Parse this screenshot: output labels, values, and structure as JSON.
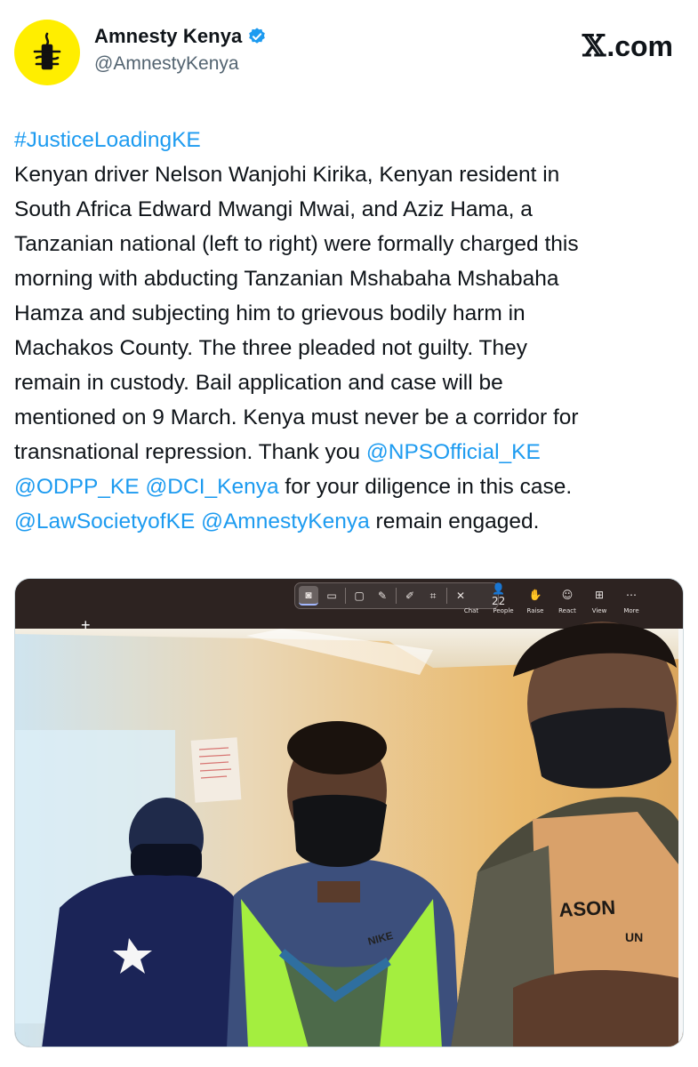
{
  "account": {
    "display_name": "Amnesty Kenya",
    "handle": "@AmnestyKenya",
    "verified": true,
    "avatar_icon": "amnesty-candle-icon",
    "avatar_color": "#ffee00"
  },
  "brand": {
    "site": ".com",
    "x_letter": "𝕏"
  },
  "tweet": {
    "lines": [
      [
        {
          "t": "#JusticeLoadingKE",
          "link": true
        }
      ],
      [
        {
          "t": "Kenyan driver Nelson Wanjohi Kirika, Kenyan resident in",
          "link": false
        }
      ],
      [
        {
          "t": "South Africa Edward Mwangi Mwai, and Aziz Hama, a",
          "link": false
        }
      ],
      [
        {
          "t": "Tanzanian national (left to right) were formally charged this",
          "link": false
        }
      ],
      [
        {
          "t": "morning with abducting Tanzanian Mshabaha Mshabaha",
          "link": false
        }
      ],
      [
        {
          "t": "Hamza and subjecting him to grievous bodily harm in",
          "link": false
        }
      ],
      [
        {
          "t": "Machakos County. The three pleaded not guilty. They",
          "link": false
        }
      ],
      [
        {
          "t": "remain in custody. Bail application and case will be",
          "link": false
        }
      ],
      [
        {
          "t": "mentioned on 9 March. Kenya must never be a corridor for",
          "link": false
        }
      ],
      [
        {
          "t": "transnational repression. Thank you ",
          "link": false
        },
        {
          "t": "@NPSOfficial_KE",
          "link": true
        }
      ],
      [
        {
          "t": "@ODPP_KE",
          "link": true
        },
        {
          "t": " ",
          "link": false
        },
        {
          "t": "@DCI_Kenya",
          "link": true
        },
        {
          "t": " for your diligence in this case.",
          "link": false
        }
      ],
      [
        {
          "t": "@LawSocietyofKE",
          "link": true
        },
        {
          "t": " ",
          "link": false
        },
        {
          "t": "@AmnestyKenya",
          "link": true
        },
        {
          "t": " remain engaged.",
          "link": false
        }
      ]
    ],
    "link_color": "#1d9bf0"
  },
  "media": {
    "meeting_controls": [
      {
        "icon": "chat-icon",
        "label": "Chat",
        "glyph": ""
      },
      {
        "icon": "people-icon",
        "label": "People",
        "glyph": "👤22"
      },
      {
        "icon": "raise-hand-icon",
        "label": "Raise",
        "glyph": "✋"
      },
      {
        "icon": "react-icon",
        "label": "React",
        "glyph": "☺"
      },
      {
        "icon": "view-icon",
        "label": "View",
        "glyph": "⊞"
      },
      {
        "icon": "more-icon",
        "label": "More",
        "glyph": "⋯"
      }
    ],
    "shirt_text": "ASON",
    "shirt_text_2": "UN",
    "jacket_text": "NIKE"
  }
}
